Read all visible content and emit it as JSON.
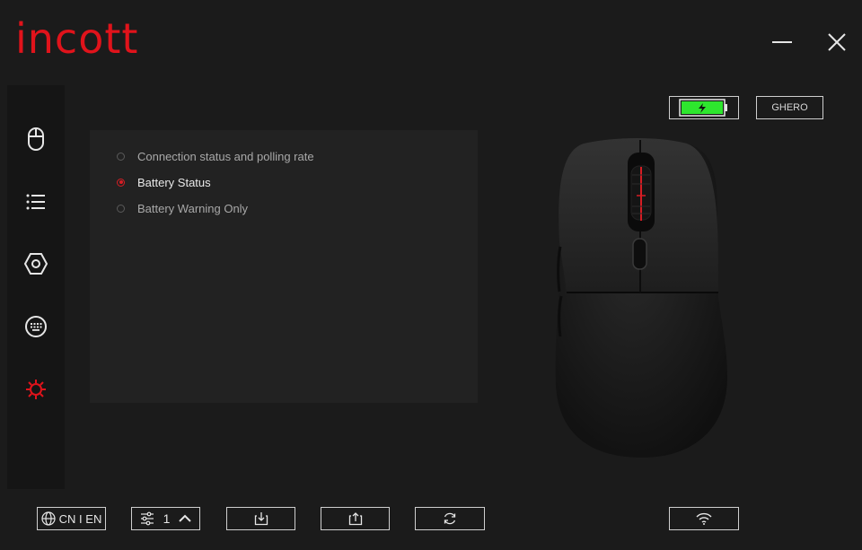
{
  "app": {
    "logo_text": "incott"
  },
  "window_controls": {
    "minimize_icon": "minimize-icon",
    "close_icon": "close-icon"
  },
  "sidebar": {
    "items": [
      {
        "icon": "mouse-icon",
        "active": false
      },
      {
        "icon": "list-icon",
        "active": false
      },
      {
        "icon": "hexagon-settings-icon",
        "active": false
      },
      {
        "icon": "keyboard-icon",
        "active": false
      },
      {
        "icon": "gear-icon",
        "active": true
      }
    ]
  },
  "settings_panel": {
    "options": [
      {
        "label": "Connection status and polling rate",
        "selected": false
      },
      {
        "label": "Battery Status",
        "selected": true
      },
      {
        "label": "Battery Warning Only",
        "selected": false
      }
    ]
  },
  "status": {
    "battery_level": 1.0,
    "battery_color": "#2ee62e",
    "profile_name": "GHERO"
  },
  "bottom_bar": {
    "language_label": "CN I EN",
    "profile_number": "1",
    "import_icon": "import-icon",
    "export_icon": "export-icon",
    "reset_icon": "reset-icon",
    "wireless_icon": "wifi-icon"
  },
  "colors": {
    "accent": "#e0131b",
    "background": "#1b1b1b",
    "panel": "#222222"
  }
}
